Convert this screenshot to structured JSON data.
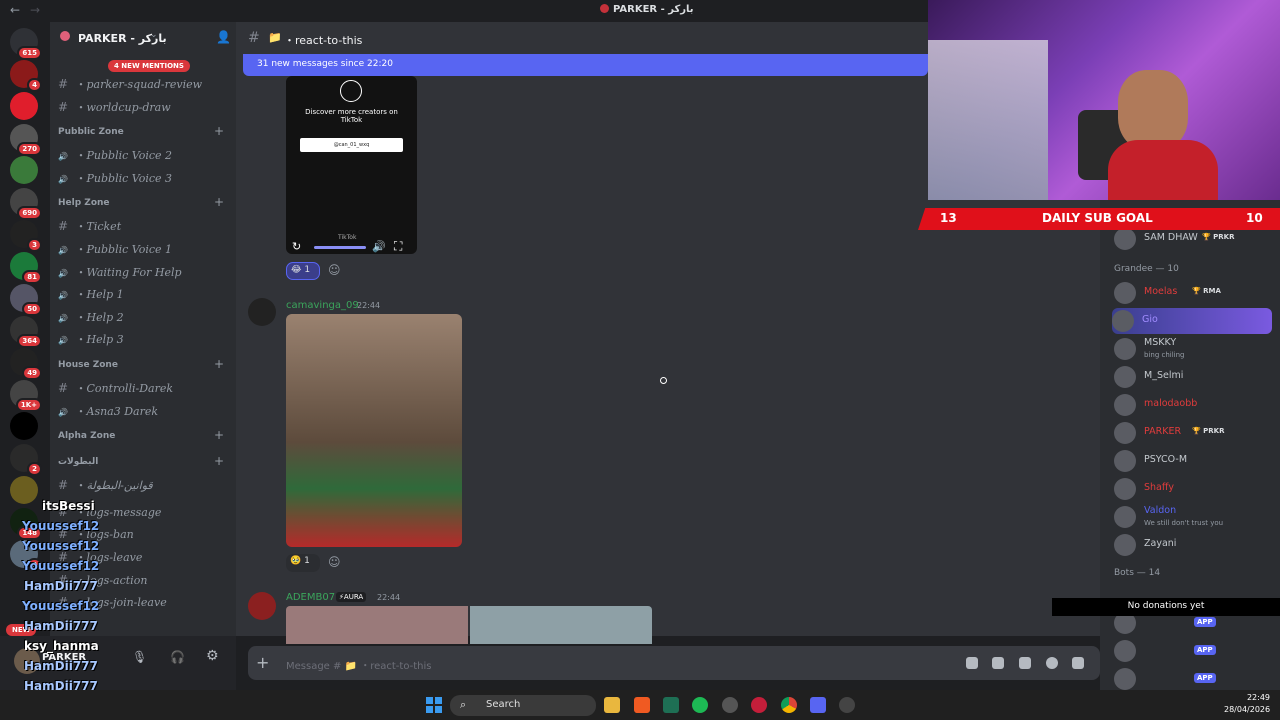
{
  "window": {
    "title": "PARKER - باركر"
  },
  "rail": {
    "badges": [
      "615",
      "4",
      "",
      "270",
      "",
      "690",
      "3",
      "81",
      "50",
      "364",
      "49",
      "1K+",
      "",
      "2",
      "",
      "148",
      "2"
    ],
    "new_label": "NEW"
  },
  "server": {
    "name": "PARKER - باركر",
    "mentions": "4 NEW MENTIONS"
  },
  "channels": {
    "top": [
      {
        "label": "parker-squad-review",
        "icon": "gear"
      },
      {
        "label": "worldcup-draw",
        "icon": "hash"
      }
    ],
    "categories": [
      {
        "name": "Pubblic Zone",
        "items": [
          "Pubblic Voice 2",
          "Pubblic Voice 3"
        ]
      },
      {
        "name": "Help Zone",
        "items": [
          "Ticket",
          "Pubblic Voice 1",
          "Waiting For Help",
          "Help 1",
          "Help 2",
          "Help 3"
        ]
      },
      {
        "name": "House Zone",
        "items": [
          "Controlli-Darek",
          "Asna3 Darek"
        ]
      },
      {
        "name": "Alpha Zone",
        "items": []
      },
      {
        "name": "البطولات",
        "items": [
          "قوانين-البطولة"
        ]
      }
    ],
    "bottom": [
      "logs-message",
      "logs-ban",
      "logs-leave",
      "logs-action",
      "logs-join-leave"
    ]
  },
  "chat": {
    "channel": "react-to-this",
    "new_messages": "31 new messages since 22:20",
    "tiktok": {
      "text": "Discover more creators on TikTok",
      "handle": "@can_01_wxq",
      "brand": "TikTok"
    },
    "reaction1": {
      "emoji": "😂",
      "count": "1"
    },
    "messages": [
      {
        "user": "camavinga_09",
        "time": "22:44",
        "reaction": {
          "emoji": "🥹",
          "count": "1"
        }
      },
      {
        "user": "ADEMB07",
        "badge": "AURA",
        "time": "22:44"
      }
    ],
    "composer_placeholder": "Message # 📁 ・react-to-this"
  },
  "user_panel": {
    "name": "PARKER"
  },
  "members": {
    "top_user": {
      "name": "SAM DHAW",
      "tag": "PRKR"
    },
    "groups": [
      {
        "name": "Grandee — 10",
        "members": [
          {
            "name": "Moelas",
            "tag": "RMA",
            "color": "#e03c3c"
          },
          {
            "name": "Gio",
            "color": "#a08cff"
          },
          {
            "name": "MSKKY",
            "status": "bing chiling",
            "color": "#c4c9ce"
          },
          {
            "name": "M_Selmi",
            "color": "#c4c9ce"
          },
          {
            "name": "malodaobb",
            "color": "#e03c3c"
          },
          {
            "name": "PARKER",
            "tag": "PRKR",
            "color": "#e03c3c"
          },
          {
            "name": "PSYCO-M",
            "color": "#c4c9ce"
          },
          {
            "name": "Shaffy",
            "color": "#e03c3c"
          },
          {
            "name": "Valdon",
            "status": "We still don't trust you",
            "color": "#5865f2"
          },
          {
            "name": "Zayani",
            "color": "#c4c9ce"
          }
        ]
      },
      {
        "name": "Bots — 14",
        "members": []
      }
    ],
    "app_tag": "APP",
    "donations": "No donations yet"
  },
  "overlay_chat": [
    {
      "name": "itsBessi",
      "color": "#ffffff"
    },
    {
      "name": "Youussef12",
      "color": "#7fb0ff"
    },
    {
      "name": "Youussef12",
      "color": "#7fb0ff"
    },
    {
      "name": "Youussef12",
      "color": "#7fb0ff"
    },
    {
      "name": "HamDii777",
      "color": "#a8c8ff"
    },
    {
      "name": "Youussef12",
      "color": "#7fb0ff"
    },
    {
      "name": "HamDii777",
      "color": "#a8c8ff"
    },
    {
      "name": "ksy_hanma",
      "color": "#ffffff"
    },
    {
      "name": "HamDii777",
      "color": "#a8c8ff"
    },
    {
      "name": "HamDii777",
      "color": "#a8c8ff"
    },
    {
      "name": "HamDii777",
      "color": "#ffffff"
    }
  ],
  "sub_goal": {
    "current": "13",
    "label": "DAILY SUB GOAL",
    "target": "10"
  },
  "taskbar": {
    "search": "Search",
    "time": "22:49",
    "date": "28/04/2026"
  }
}
